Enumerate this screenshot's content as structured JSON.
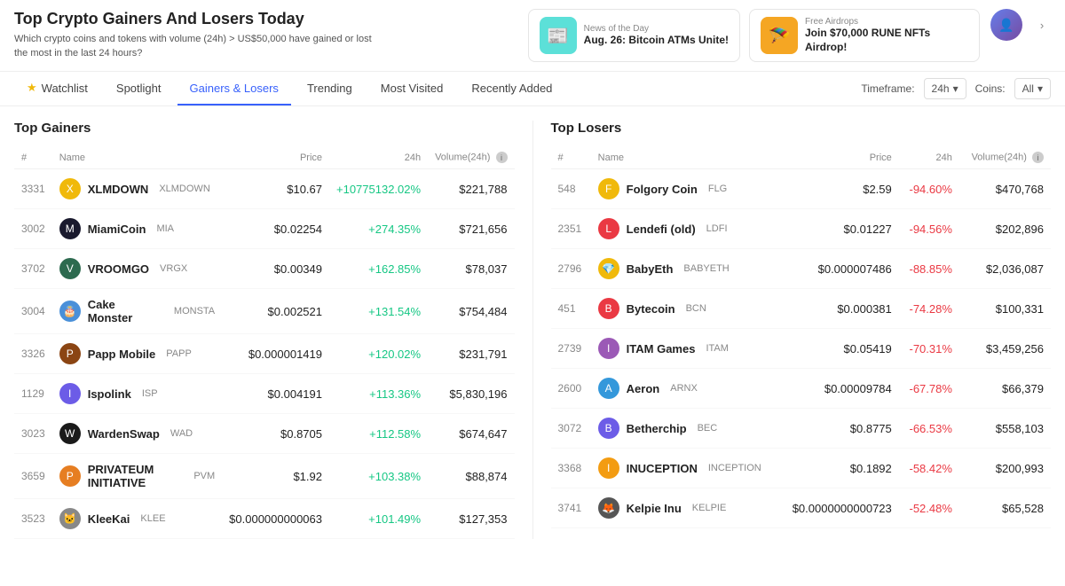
{
  "header": {
    "title": "Top Crypto Gainers And Losers Today",
    "subtitle": "Which crypto coins and tokens with volume (24h) > US$50,000 have gained or lost the most in the last 24 hours?",
    "news": [
      {
        "label": "News of the Day",
        "title": "Aug. 26: Bitcoin ATMs Unite!",
        "icon": "📰",
        "bg": "teal"
      },
      {
        "label": "Free Airdrops",
        "title": "Join $70,000 RUNE NFTs Airdrop!",
        "icon": "🪂",
        "bg": "orange"
      }
    ],
    "chevron": "›"
  },
  "nav": {
    "items": [
      {
        "id": "watchlist",
        "label": "Watchlist",
        "icon": "★",
        "active": false
      },
      {
        "id": "spotlight",
        "label": "Spotlight",
        "icon": "",
        "active": false
      },
      {
        "id": "gainers-losers",
        "label": "Gainers & Losers",
        "icon": "",
        "active": true
      },
      {
        "id": "trending",
        "label": "Trending",
        "icon": "",
        "active": false
      },
      {
        "id": "most-visited",
        "label": "Most Visited",
        "icon": "",
        "active": false
      },
      {
        "id": "recently-added",
        "label": "Recently Added",
        "icon": "",
        "active": false
      }
    ],
    "timeframe_label": "Timeframe:",
    "timeframe_value": "24h",
    "coins_label": "Coins:",
    "coins_value": "All"
  },
  "gainers": {
    "title": "Top Gainers",
    "columns": [
      "#",
      "Name",
      "Price",
      "24h",
      "Volume(24h)"
    ],
    "rows": [
      {
        "rank": "3331",
        "name": "XLMDOWN",
        "ticker": "XLMDOWN",
        "price": "$10.67",
        "change": "+10775132.02%",
        "volume": "$221,788",
        "color": "#f0b90b",
        "letter": "X"
      },
      {
        "rank": "3002",
        "name": "MiamiCoin",
        "ticker": "MIA",
        "price": "$0.02254",
        "change": "+274.35%",
        "volume": "$721,656",
        "color": "#1a1a2e",
        "letter": "M"
      },
      {
        "rank": "3702",
        "name": "VROOMGO",
        "ticker": "VRGX",
        "price": "$0.00349",
        "change": "+162.85%",
        "volume": "$78,037",
        "color": "#2d6a4f",
        "letter": "V"
      },
      {
        "rank": "3004",
        "name": "Cake Monster",
        "ticker": "MONSTA",
        "price": "$0.002521",
        "change": "+131.54%",
        "volume": "$754,484",
        "color": "#4a90d9",
        "letter": "🎂"
      },
      {
        "rank": "3326",
        "name": "Papp Mobile",
        "ticker": "PAPP",
        "price": "$0.000001419",
        "change": "+120.02%",
        "volume": "$231,791",
        "color": "#8B4513",
        "letter": "P"
      },
      {
        "rank": "1129",
        "name": "Ispolink",
        "ticker": "ISP",
        "price": "$0.004191",
        "change": "+113.36%",
        "volume": "$5,830,196",
        "color": "#6c5ce7",
        "letter": "I"
      },
      {
        "rank": "3023",
        "name": "WardenSwap",
        "ticker": "WAD",
        "price": "$0.8705",
        "change": "+112.58%",
        "volume": "$674,647",
        "color": "#1a1a1a",
        "letter": "W"
      },
      {
        "rank": "3659",
        "name": "PRIVATEUM INITIATIVE",
        "ticker": "PVM",
        "price": "$1.92",
        "change": "+103.38%",
        "volume": "$88,874",
        "color": "#e67e22",
        "letter": "P"
      },
      {
        "rank": "3523",
        "name": "KleeKai",
        "ticker": "KLEE",
        "price": "$0.000000000063",
        "change": "+101.49%",
        "volume": "$127,353",
        "color": "#888",
        "letter": "🐱"
      }
    ]
  },
  "losers": {
    "title": "Top Losers",
    "columns": [
      "#",
      "Name",
      "Price",
      "24h",
      "Volume(24h)"
    ],
    "rows": [
      {
        "rank": "548",
        "name": "Folgory Coin",
        "ticker": "FLG",
        "price": "$2.59",
        "change": "-94.60%",
        "volume": "$470,768",
        "color": "#f0b90b",
        "letter": "F"
      },
      {
        "rank": "2351",
        "name": "Lendefi (old)",
        "ticker": "LDFI",
        "price": "$0.01227",
        "change": "-94.56%",
        "volume": "$202,896",
        "color": "#ea3943",
        "letter": "L"
      },
      {
        "rank": "2796",
        "name": "BabyEth",
        "ticker": "BABYETH",
        "price": "$0.000007486",
        "change": "-88.85%",
        "volume": "$2,036,087",
        "color": "#f0b90b",
        "letter": "💎"
      },
      {
        "rank": "451",
        "name": "Bytecoin",
        "ticker": "BCN",
        "price": "$0.000381",
        "change": "-74.28%",
        "volume": "$100,331",
        "color": "#ea3943",
        "letter": "B"
      },
      {
        "rank": "2739",
        "name": "ITAM Games",
        "ticker": "ITAM",
        "price": "$0.05419",
        "change": "-70.31%",
        "volume": "$3,459,256",
        "color": "#9b59b6",
        "letter": "I"
      },
      {
        "rank": "2600",
        "name": "Aeron",
        "ticker": "ARNX",
        "price": "$0.00009784",
        "change": "-67.78%",
        "volume": "$66,379",
        "color": "#3498db",
        "letter": "A"
      },
      {
        "rank": "3072",
        "name": "Betherchip",
        "ticker": "BEC",
        "price": "$0.8775",
        "change": "-66.53%",
        "volume": "$558,103",
        "color": "#6c5ce7",
        "letter": "B"
      },
      {
        "rank": "3368",
        "name": "INUCEPTION",
        "ticker": "INCEPTION",
        "price": "$0.1892",
        "change": "-58.42%",
        "volume": "$200,993",
        "color": "#f39c12",
        "letter": "I"
      },
      {
        "rank": "3741",
        "name": "Kelpie Inu",
        "ticker": "KELPIE",
        "price": "$0.0000000000723",
        "change": "-52.48%",
        "volume": "$65,528",
        "color": "#555",
        "letter": "🦊"
      }
    ]
  }
}
